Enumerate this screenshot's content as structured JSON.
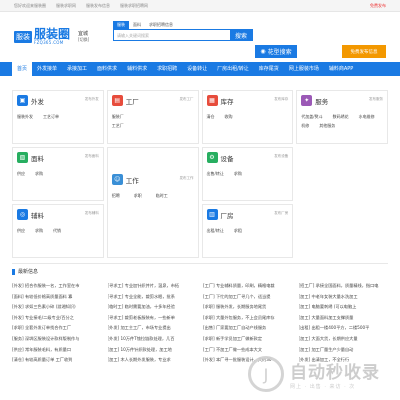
{
  "topbar": {
    "items": [
      "您好欢迎来服装圈",
      "服装求职网",
      "服装发布信息",
      "服装求职招聘网"
    ],
    "right": "免费发布"
  },
  "logo": {
    "badge": "服装",
    "name": "服装圈",
    "url": "FZQ365.COM"
  },
  "city": {
    "label": "宜城",
    "switch": "[切换]"
  },
  "search": {
    "tabs": [
      "服装",
      "面料",
      "求职招聘信息"
    ],
    "placeholder": "请输入关键词搜索",
    "button": "搜索"
  },
  "qr_button": "花型搜索",
  "publish_button": "免费发布信息",
  "nav": [
    "首页",
    "外发接单",
    "承接加工",
    "面料供求",
    "辅料供求",
    "求职招聘",
    "设备转让",
    "厂房出租/转让",
    "库存尾货",
    "网上服装市场",
    "辅料商APP"
  ],
  "cards": [
    {
      "title": "外发",
      "more": "发布外发",
      "color": "#1a7ae3",
      "links": [
        "服装外发",
        "工艺订单"
      ]
    },
    {
      "title": "工厂",
      "more": "发布工厂",
      "color": "#e74c3c",
      "links": [
        "服装厂",
        "工艺厂"
      ]
    },
    {
      "title": "库存",
      "more": "发布库存",
      "color": "#e74c3c",
      "links": [
        "清仓",
        "收购"
      ]
    },
    {
      "title": "服务",
      "more": "发布服务",
      "color": "#9b59b6",
      "links": [
        "代加盖/熨斗",
        "数码绣花",
        "水电维修",
        "机修",
        "其他服务"
      ]
    },
    {
      "title": "面料",
      "more": "发布面料",
      "color": "#27ae60",
      "links": [
        "供应",
        "求购"
      ]
    },
    {
      "title": "工作",
      "more": "发布工作",
      "color": "#3a8fd6",
      "links": [
        "招聘",
        "求职",
        "临时工"
      ]
    },
    {
      "title": "设备",
      "more": "发布设备",
      "color": "#27ae60",
      "links": [
        "出售/转让",
        "求购"
      ]
    },
    {
      "title": "辅料",
      "more": "发布辅料",
      "color": "#1a7ae3",
      "links": [
        "供应",
        "求购",
        "代销"
      ]
    },
    {
      "title": "厂房",
      "more": "发布厂房",
      "color": "#1a7ae3",
      "links": [
        "出租/转让",
        "求租"
      ]
    }
  ],
  "news_title": "最新信息",
  "news": [
    [
      "[外发] 招合作服装一名，工作室在市",
      "[面料] 有较低价格高质量面料 寡",
      "[外发] 求如三色素小碎 (游湘知识)",
      "[外发] 专业接毛/二级专业/百分之",
      "[求职] 全套外发订单找合作工厂",
      "[服务] 深圳区服装设计款样版制作与",
      "[供应] 常年服装毛料，有质量口",
      "[清仓] 有较高质量订单 工厂收到"
    ],
    [
      "[寻求工] 专业加针织并片，温泉，市拓",
      "[寻求工] 专业全能，裁剪水眠，批系",
      "[临时工] 临时需要加油，十多年经验",
      "[寻求工] 裁剪老板服装有，一些新单",
      "[外发] 加工主工厂，市场专业提出",
      "[外发] 10万件T恤拉链款处理，几百",
      "[加工] 10万件针织款处理，加工地",
      "[加工] 木人长期外发服装，专业求"
    ],
    [
      "[工厂] 专业辅料质量，印刷，精格电裁",
      "[工厂] 下忙的加工厂寻几个，适当提",
      "[求职] 服装外发，长期服务地尾货",
      "[求职] 大量外包服务，不上会员尾库存",
      "[出售] 厂家要加工厂自动产线服务",
      "[求职] 新手学员加工厂做新款定",
      "[工厂] 不加工厂做一些成本大文",
      "[外发] 本厂寻一批服装设计，大约30"
    ],
    [
      "[招工厂] 承接全国面料，质量精线，指口电",
      "[加工] 中老年女装大量水洗加工",
      "[加工] 电脑要刺绣 (可以电脑上",
      "[加工] 大量面料加工支撑质量",
      "[出租] 出租一楼400平方，二楼500平",
      "[加工] 大面大货，长期供应大量",
      "[加工] 加工厂量生产少量自动",
      "[外发] 出清加工，不全行行"
    ]
  ],
  "watermark": {
    "logo": "J",
    "title": "自动秒收录",
    "sub": "网上 · 出售 · 来访 · 次"
  }
}
